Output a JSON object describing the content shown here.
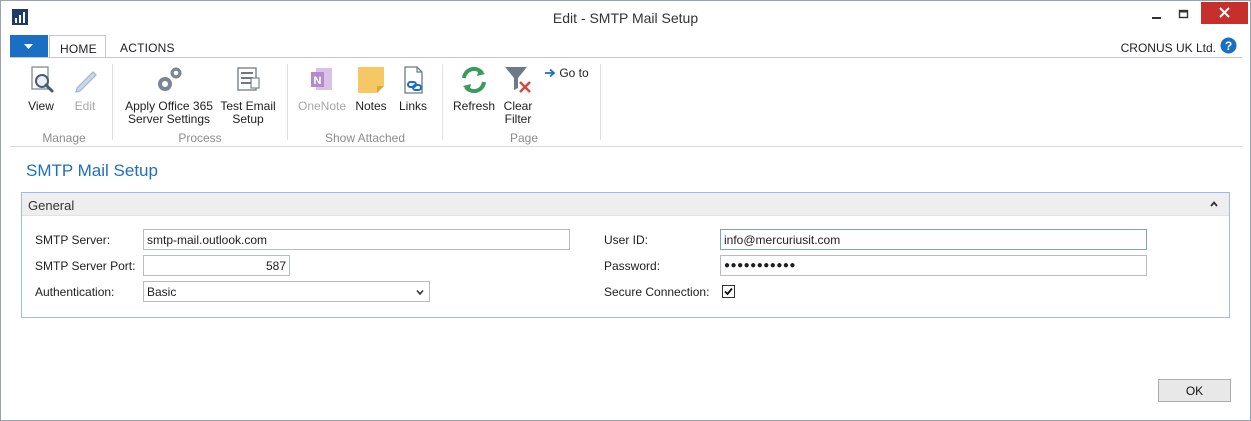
{
  "window": {
    "title": "Edit - SMTP Mail Setup",
    "controls": [
      "minimize",
      "maximize",
      "close"
    ]
  },
  "ribbon_tabs": [
    {
      "label": "HOME",
      "active": true
    },
    {
      "label": "ACTIONS",
      "active": false
    }
  ],
  "company": "CRONUS UK Ltd.",
  "ribbon": {
    "groups": [
      {
        "label": "Manage",
        "buttons": [
          {
            "label": "View",
            "icon": "view-magnifier-icon",
            "enabled": true
          },
          {
            "label": "Edit",
            "icon": "edit-pencil-icon",
            "enabled": false
          }
        ]
      },
      {
        "label": "Process",
        "buttons": [
          {
            "label_line1": "Apply Office 365",
            "label_line2": "Server Settings",
            "icon": "gears-icon",
            "enabled": true
          },
          {
            "label_line1": "Test Email",
            "label_line2": "Setup",
            "icon": "document-lines-icon",
            "enabled": true
          }
        ]
      },
      {
        "label": "Show Attached",
        "buttons": [
          {
            "label": "OneNote",
            "icon": "onenote-icon",
            "enabled": false
          },
          {
            "label": "Notes",
            "icon": "note-icon",
            "enabled": true
          },
          {
            "label": "Links",
            "icon": "link-document-icon",
            "enabled": true
          }
        ]
      },
      {
        "label": "Page",
        "buttons": [
          {
            "label": "Refresh",
            "icon": "refresh-icon",
            "enabled": true
          },
          {
            "label_line1": "Clear",
            "label_line2": "Filter",
            "icon": "clear-filter-icon",
            "enabled": true
          },
          {
            "label": "Go to",
            "icon": "arrow-right-icon",
            "enabled": true
          }
        ]
      }
    ]
  },
  "page": {
    "title": "SMTP Mail Setup",
    "section": {
      "title": "General",
      "fields": {
        "smtp_server": {
          "label": "SMTP Server:",
          "value": "smtp-mail.outlook.com"
        },
        "smtp_port": {
          "label": "SMTP Server Port:",
          "value": "587"
        },
        "authentication": {
          "label": "Authentication:",
          "value": "Basic"
        },
        "user_id": {
          "label": "User ID:",
          "value": "info@mercuriusit.com"
        },
        "password": {
          "label": "Password:",
          "value": "●●●●●●●●●●●"
        },
        "secure_connection": {
          "label": "Secure Connection:",
          "checked": true
        }
      }
    }
  },
  "footer": {
    "ok_label": "OK"
  },
  "colors": {
    "accent": "#1a6fc4",
    "title_blue": "#1e6fbf",
    "close_red": "#c7302a",
    "fasttab_border": "#9ebde6"
  }
}
